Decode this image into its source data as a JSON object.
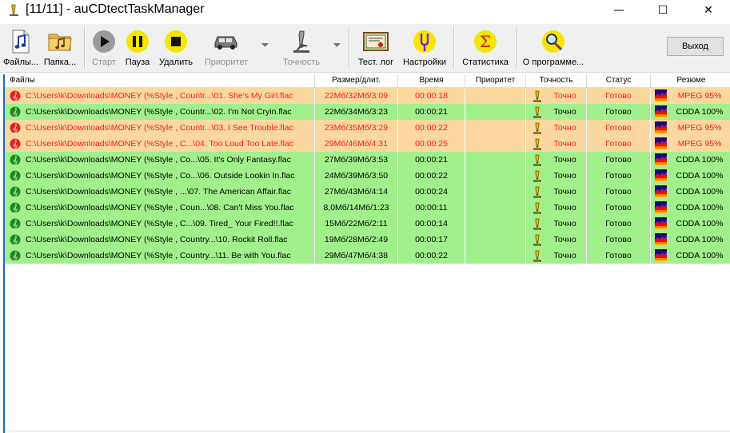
{
  "window": {
    "title": "[11/11] - auCDtectTaskManager",
    "minimize": "—",
    "maximize": "☐",
    "close": "✕"
  },
  "toolbar": {
    "files": "Файлы...",
    "folder": "Папка...",
    "start": "Старт",
    "pause": "Пауза",
    "delete": "Удалить",
    "priority": "Приоритет",
    "precision": "Точность",
    "test_log": "Тест. лог",
    "settings": "Настройки",
    "statistics": "Статистика",
    "about": "О программе...",
    "exit": "Выход"
  },
  "columns": {
    "files": "Файлы",
    "size": "Размер/длит.",
    "time": "Время",
    "priority": "Приоритет",
    "precision": "Точность",
    "status": "Статус",
    "summary": "Резюме"
  },
  "colors": {
    "orange": "#fbd8a0",
    "green": "#a0f08c",
    "red_text": "#ff1a1a",
    "black_text": "#000000"
  },
  "rows": [
    {
      "file": "C:\\Users\\k\\Downloads\\MONEY  (%Style , Countr...\\01. She's My Girl.flac",
      "size": "22Мб/32Мб/3:09",
      "time": "00:00:18",
      "priority": "",
      "precision": "Точно",
      "status": "Готово",
      "summary": "MPEG 95%",
      "state": "mpeg"
    },
    {
      "file": "C:\\Users\\k\\Downloads\\MONEY  (%Style , Countr...\\02. I'm Not Cryin.flac",
      "size": "22Мб/34Мб/3:23",
      "time": "00:00:21",
      "priority": "",
      "precision": "Точно",
      "status": "Готово",
      "summary": "CDDA 100%",
      "state": "cdda"
    },
    {
      "file": "C:\\Users\\k\\Downloads\\MONEY  (%Style , Countr...\\03. I See Trouble.flac",
      "size": "23Мб/35Мб/3:29",
      "time": "00:00:22",
      "priority": "",
      "precision": "Точно",
      "status": "Готово",
      "summary": "MPEG 95%",
      "state": "mpeg"
    },
    {
      "file": "C:\\Users\\k\\Downloads\\MONEY  (%Style , C...\\04. Too Loud Too Late.flac",
      "size": "29Мб/46Мб/4:31",
      "time": "00:00:25",
      "priority": "",
      "precision": "Точно",
      "status": "Готово",
      "summary": "MPEG 95%",
      "state": "mpeg"
    },
    {
      "file": "C:\\Users\\k\\Downloads\\MONEY  (%Style , Co...\\05. It's Only Fantasy.flac",
      "size": "27Мб/39Мб/3:53",
      "time": "00:00:21",
      "priority": "",
      "precision": "Точно",
      "status": "Готово",
      "summary": "CDDA 100%",
      "state": "cdda"
    },
    {
      "file": "C:\\Users\\k\\Downloads\\MONEY  (%Style , Co...\\06. Outside Lookin In.flac",
      "size": "24Мб/39Мб/3:50",
      "time": "00:00:22",
      "priority": "",
      "precision": "Точно",
      "status": "Готово",
      "summary": "CDDA 100%",
      "state": "cdda"
    },
    {
      "file": "C:\\Users\\k\\Downloads\\MONEY  (%Style , ...\\07. The American Affair.flac",
      "size": "27Мб/43Мб/4:14",
      "time": "00:00:24",
      "priority": "",
      "precision": "Точно",
      "status": "Готово",
      "summary": "CDDA 100%",
      "state": "cdda"
    },
    {
      "file": "C:\\Users\\k\\Downloads\\MONEY  (%Style , Coun...\\08. Can't Miss You.flac",
      "size": "8,0Мб/14Мб/1:23",
      "time": "00:00:11",
      "priority": "",
      "precision": "Точно",
      "status": "Готово",
      "summary": "CDDA 100%",
      "state": "cdda"
    },
    {
      "file": "C:\\Users\\k\\Downloads\\MONEY  (%Style , C...\\09. Tired_ Your Fired!!.flac",
      "size": "15Мб/22Мб/2:11",
      "time": "00:00:14",
      "priority": "",
      "precision": "Точно",
      "status": "Готово",
      "summary": "CDDA 100%",
      "state": "cdda"
    },
    {
      "file": "C:\\Users\\k\\Downloads\\MONEY  (%Style , Country...\\10. Rockit Roll.flac",
      "size": "19Мб/28Мб/2:49",
      "time": "00:00:17",
      "priority": "",
      "precision": "Точно",
      "status": "Готово",
      "summary": "CDDA 100%",
      "state": "cdda"
    },
    {
      "file": "C:\\Users\\k\\Downloads\\MONEY  (%Style , Country...\\11. Be with You.flac",
      "size": "29Мб/47Мб/4:38",
      "time": "00:00:22",
      "priority": "",
      "precision": "Точно",
      "status": "Готово",
      "summary": "CDDA 100%",
      "state": "cdda"
    }
  ]
}
